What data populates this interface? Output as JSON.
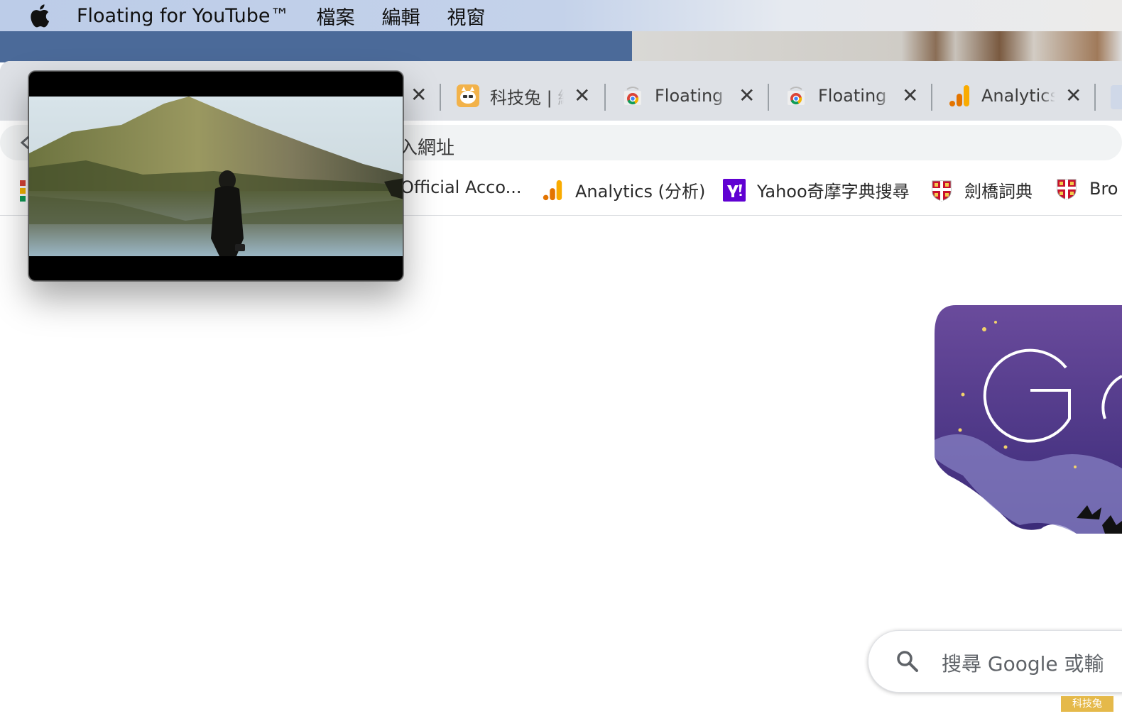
{
  "menubar": {
    "app_name": "Floating for YouTube™",
    "items": [
      "檔案",
      "編輯",
      "視窗"
    ]
  },
  "tabs": [
    {
      "label": "科技兔 | 網",
      "icon": "kejitu-icon"
    },
    {
      "label": "Floating f",
      "icon": "chrome-webstore-icon"
    },
    {
      "label": "Floating f",
      "icon": "chrome-webstore-icon"
    },
    {
      "label": "Analytics",
      "icon": "analytics-icon"
    }
  ],
  "omnibox": {
    "placeholder_fragment": "入網址"
  },
  "bookmarks": [
    {
      "label": "Official Acco...",
      "icon": ""
    },
    {
      "label": "Analytics (分析)",
      "icon": "analytics-icon"
    },
    {
      "label": "Yahoo奇摩字典搜尋",
      "icon": "yahoo-icon"
    },
    {
      "label": "劍橋詞典",
      "icon": "cambridge-icon"
    },
    {
      "label": "Bro",
      "icon": "cambridge-icon"
    }
  ],
  "search": {
    "placeholder": "搜尋 Google 或輸"
  },
  "watermark": "科技兔",
  "colors": {
    "menubar": "#c4d2ea",
    "desktop": "#4b6a99",
    "tabstrip": "#dee1e6",
    "analytics_orange": "#f9ab00",
    "yahoo_purple": "#6001d2",
    "doodle_purple": "#5b3d8f"
  }
}
